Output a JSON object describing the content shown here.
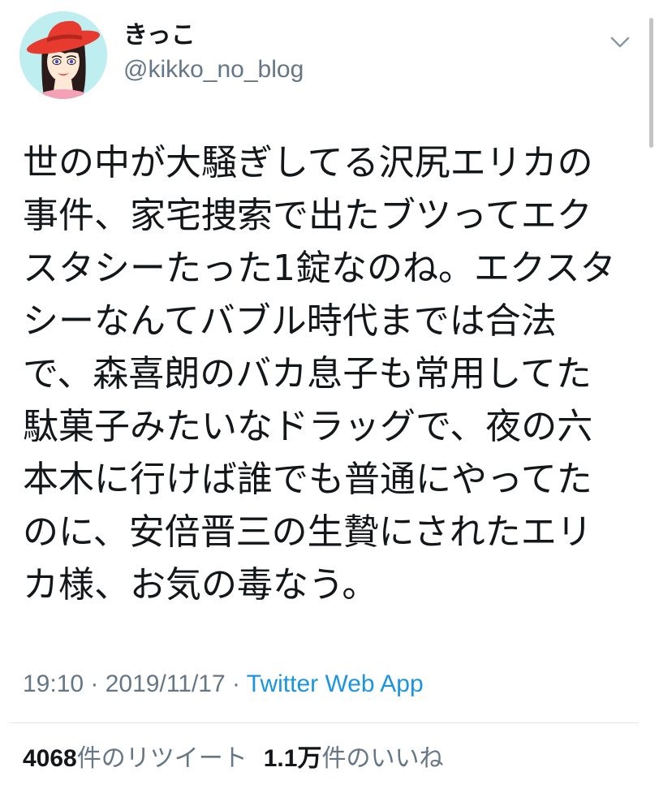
{
  "user": {
    "display_name": "きっこ",
    "handle": "@kikko_no_blog",
    "avatar_icon": "avatar-red-hat-woman"
  },
  "tweet": {
    "text": "世の中が大騒ぎしてる沢尻エリカの事件、家宅捜索で出たブツってエクスタシーたった1錠なのね。エクスタシーなんてバブル時代までは合法で、森喜朗のバカ息子も常用してた駄菓子みたいなドラッグで、夜の六本木に行けば誰でも普通にやってたのに、安倍晋三の生贄にされたエリカ様、お気の毒なう。",
    "time": "19:10",
    "date": "2019/11/17",
    "separator": " · ",
    "source": "Twitter Web App"
  },
  "stats": {
    "retweets_count": "4068",
    "retweets_label": "件のリツイート",
    "likes_count": "1.1万",
    "likes_label": "件のいいね"
  },
  "menu": {
    "icon": "chevron-down-icon"
  },
  "colors": {
    "text": "#14171a",
    "secondary": "#657786",
    "link": "#1b95e0",
    "divider": "#e1e8ed"
  }
}
